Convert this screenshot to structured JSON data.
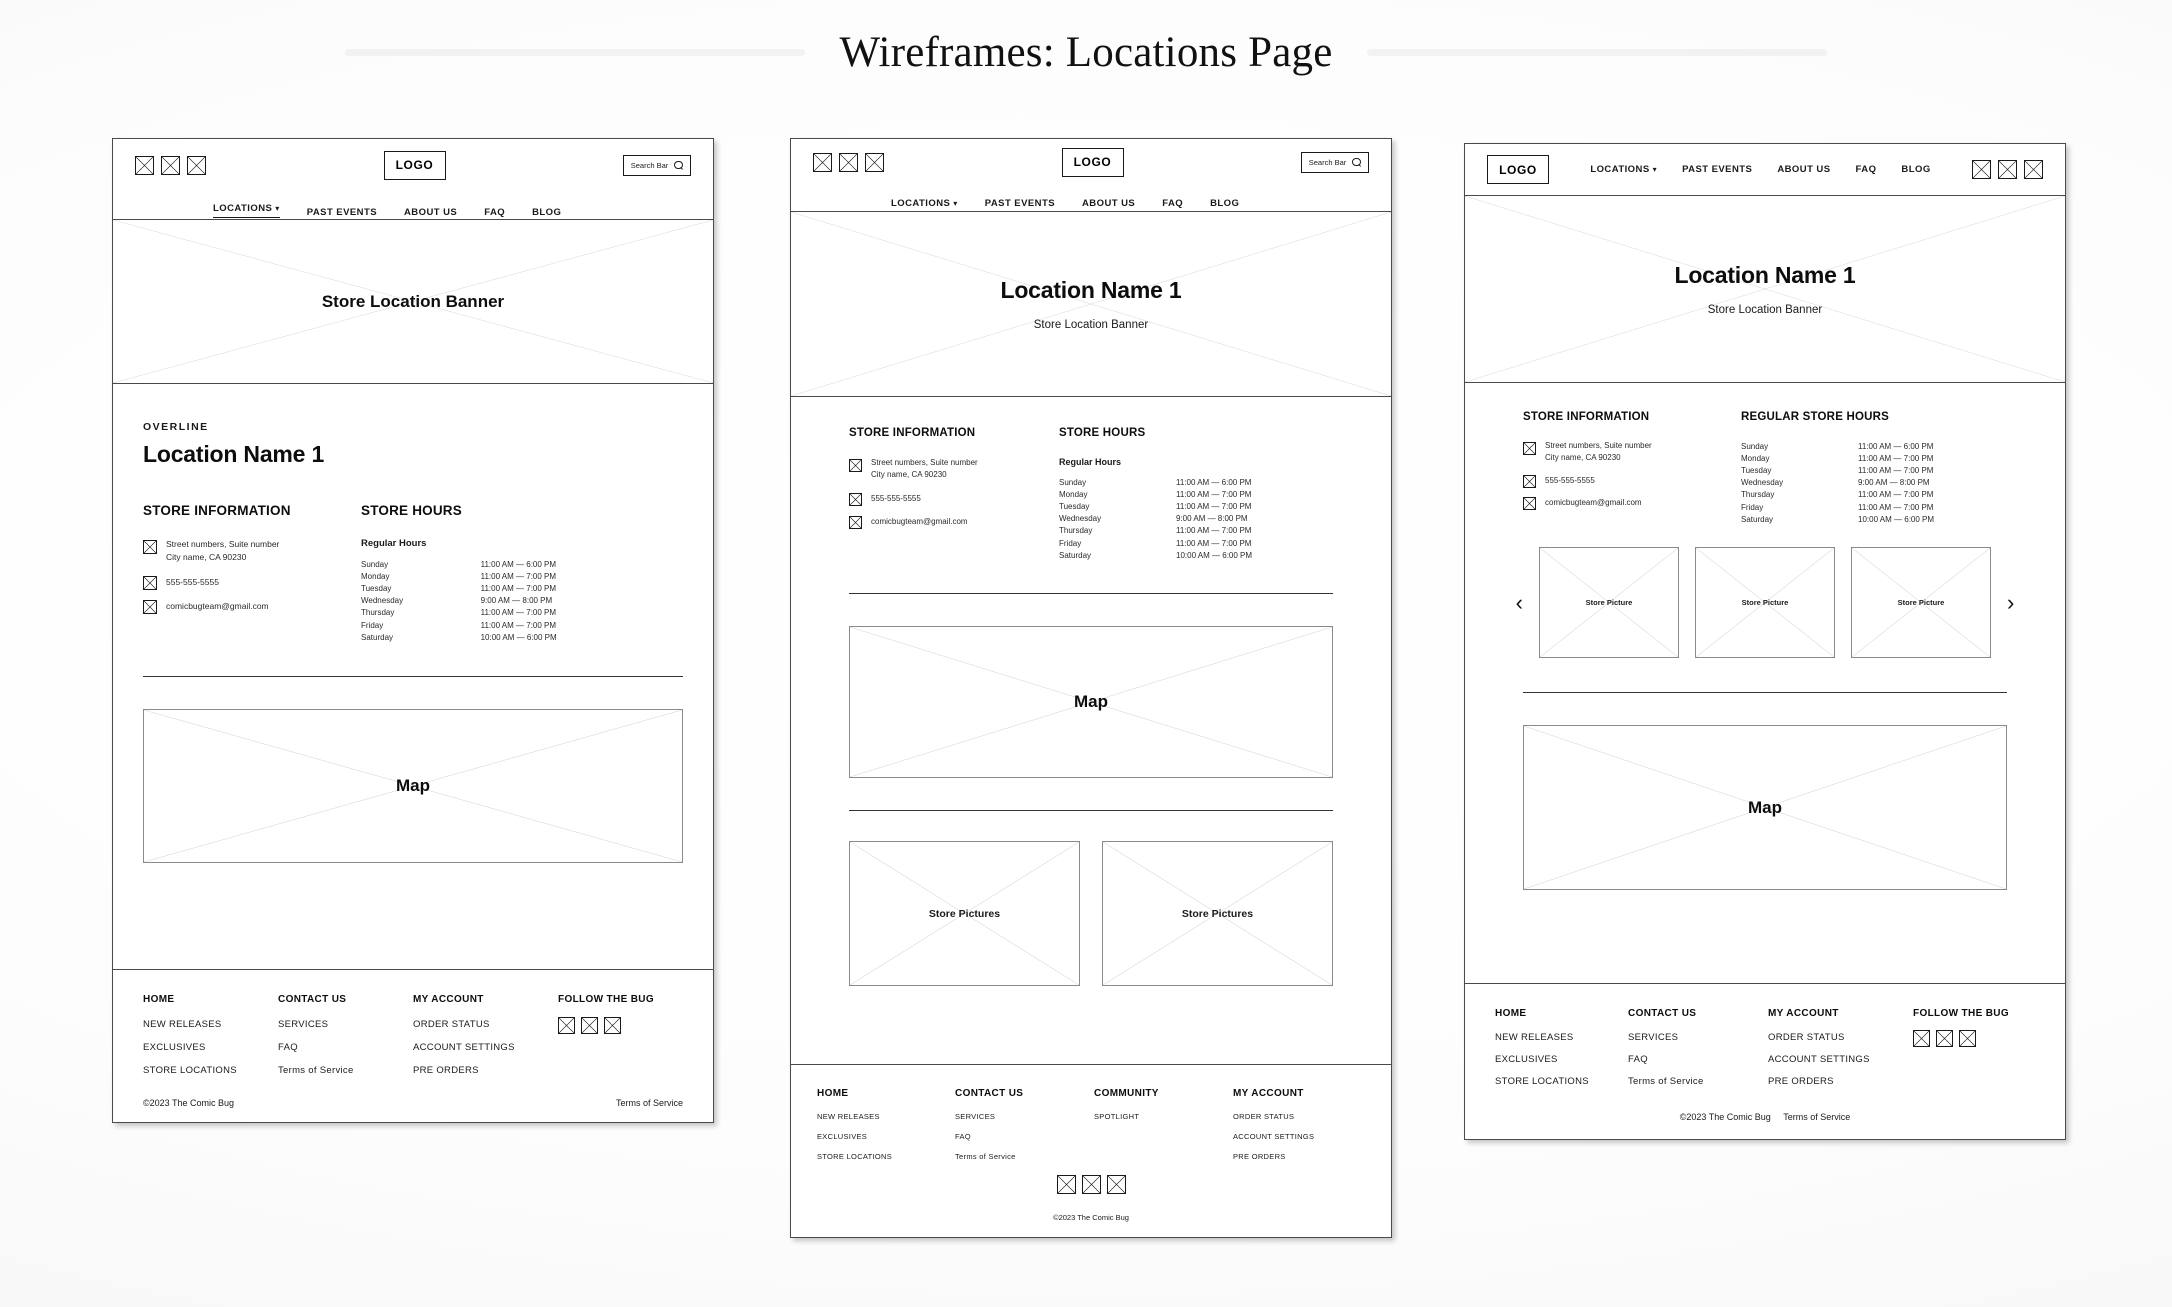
{
  "page": {
    "title": "Wireframes: Locations Page"
  },
  "shared": {
    "logo": "LOGO",
    "search_placeholder": "Search Bar",
    "nav": [
      {
        "label": "LOCATIONS",
        "has_chevron": true,
        "active": true
      },
      {
        "label": "PAST EVENTS",
        "has_chevron": false,
        "active": false
      },
      {
        "label": "ABOUT US",
        "has_chevron": false,
        "active": false
      },
      {
        "label": "FAQ",
        "has_chevron": false,
        "active": false
      },
      {
        "label": "BLOG",
        "has_chevron": false,
        "active": false
      }
    ],
    "store_information_heading": "STORE INFORMATION",
    "store_hours_heading": "STORE HOURS",
    "regular_store_hours_heading": "REGULAR STORE HOURS",
    "regular_hours_label": "Regular Hours",
    "address_line1": "Street numbers, Suite number",
    "address_line2": "City name, CA 90230",
    "phone": "555-555-5555",
    "email": "comicbugteam@gmail.com",
    "map_label": "Map",
    "banner_label": "Store Location Banner",
    "location_name": "Location Name 1",
    "overline": "OVERLINE",
    "hours": [
      {
        "day": "Sunday",
        "time": "11:00 AM — 6:00 PM"
      },
      {
        "day": "Monday",
        "time": "11:00 AM — 7:00 PM"
      },
      {
        "day": "Tuesday",
        "time": "11:00 AM — 7:00 PM"
      },
      {
        "day": "Wednesday",
        "time": "9:00 AM — 8:00 PM"
      },
      {
        "day": "Thursday",
        "time": "11:00 AM — 7:00 PM"
      },
      {
        "day": "Friday",
        "time": "11:00 AM — 7:00 PM"
      },
      {
        "day": "Saturday",
        "time": "10:00 AM — 6:00 PM"
      }
    ],
    "copyright": "©2023 The Comic Bug",
    "terms": "Terms of Service",
    "store_picture_label": "Store Picture",
    "store_pictures_label": "Store Pictures",
    "carousel_prev": "‹",
    "carousel_next": "›"
  },
  "panel1": {
    "footer": {
      "columns": [
        {
          "head": "HOME",
          "links": [
            "NEW RELEASES",
            "EXCLUSIVES",
            "STORE LOCATIONS"
          ]
        },
        {
          "head": "CONTACT US",
          "links": [
            "SERVICES",
            "FAQ",
            "Terms of Service"
          ]
        },
        {
          "head": "MY ACCOUNT",
          "links": [
            "ORDER STATUS",
            "ACCOUNT SETTINGS",
            "PRE ORDERS"
          ]
        },
        {
          "head": "FOLLOW THE BUG",
          "links": []
        }
      ],
      "copyright": "©2023 The Comic Bug",
      "terms": "Terms of Service"
    }
  },
  "panel2": {
    "footer": {
      "columns": [
        {
          "head": "HOME",
          "links": [
            "NEW RELEASES",
            "EXCLUSIVES",
            "STORE LOCATIONS"
          ]
        },
        {
          "head": "CONTACT US",
          "links": [
            "SERVICES",
            "FAQ",
            "Terms of Service"
          ]
        },
        {
          "head": "COMMUNITY",
          "links": [
            "SPOTLIGHT"
          ]
        },
        {
          "head": "MY ACCOUNT",
          "links": [
            "ORDER STATUS",
            "ACCOUNT SETTINGS",
            "PRE ORDERS"
          ]
        }
      ],
      "copyright": "©2023 The Comic Bug"
    }
  },
  "panel3": {
    "footer": {
      "columns": [
        {
          "head": "HOME",
          "links": [
            "NEW RELEASES",
            "EXCLUSIVES",
            "STORE LOCATIONS"
          ]
        },
        {
          "head": "CONTACT US",
          "links": [
            "SERVICES",
            "FAQ",
            "Terms of Service"
          ]
        },
        {
          "head": "MY ACCOUNT",
          "links": [
            "ORDER STATUS",
            "ACCOUNT SETTINGS",
            "PRE ORDERS"
          ]
        },
        {
          "head": "FOLLOW THE BUG",
          "links": []
        }
      ],
      "copyright": "©2023 The Comic Bug",
      "terms": "Terms of Service"
    }
  }
}
